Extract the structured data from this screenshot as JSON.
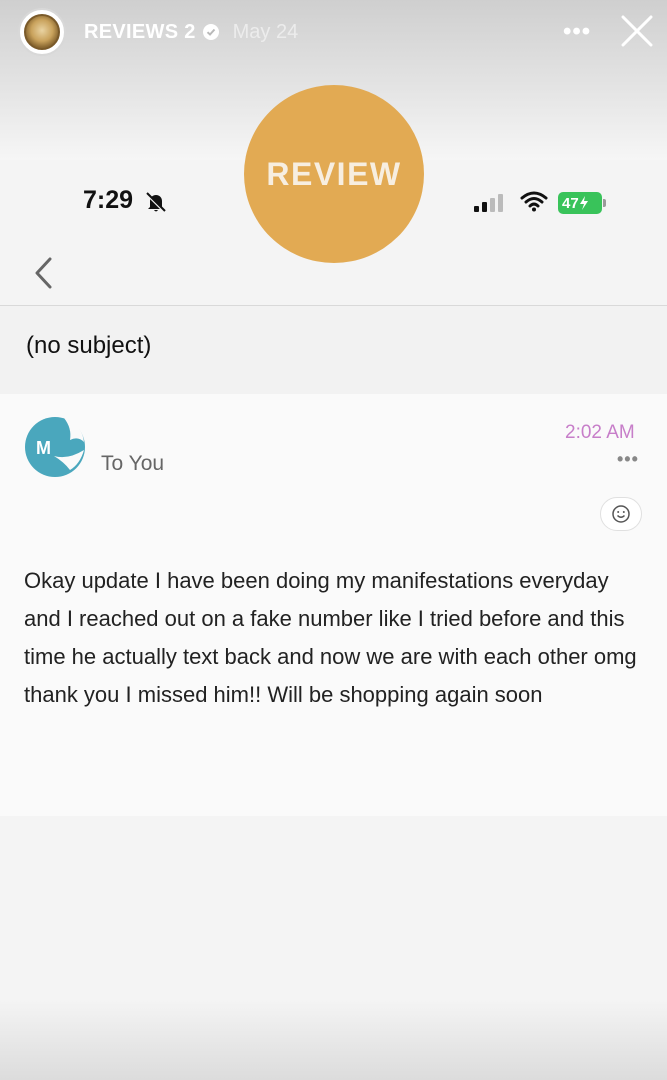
{
  "story": {
    "account_name": "REVIEWS 2",
    "date": "May 24",
    "more_label": "•••",
    "close_icon": "close-icon",
    "verified_icon": "verified-badge-icon"
  },
  "sticker": {
    "label": "REVIEW"
  },
  "status_bar": {
    "time": "7:29",
    "battery": "47"
  },
  "email": {
    "subject": "(no subject)",
    "recipient": "To You",
    "time": "2:02 AM",
    "more_label": "•••",
    "body": "Okay update I have been doing my manifestations everyday and I reached out on a fake number like I tried before and this time he actually text back and now we are with each other omg thank you I missed him!! Will be shopping again soon"
  },
  "colors": {
    "sticker": "#e2aa53",
    "time_accent": "#c77ec9",
    "sender_logo": "#4aa7bd",
    "battery": "#39c35a"
  }
}
